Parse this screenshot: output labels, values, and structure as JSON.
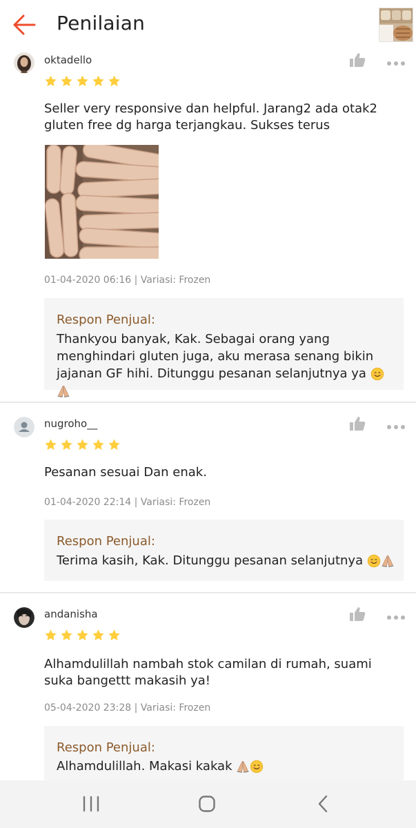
{
  "header": {
    "title": "Penilaian",
    "back_icon": "arrow-left-icon",
    "accent_color": "#ee4d2d"
  },
  "colors": {
    "star": "#ffce3d",
    "seller_label": "#8b5a2b",
    "meta": "#8b8b8b"
  },
  "reviews": [
    {
      "username": "oktadello",
      "rating": 5,
      "comment": "Seller very responsive dan helpful. Jarang2 ada otak2 gluten free dg harga terjangkau. Sukses terus",
      "meta": "01-04-2020 06:16 | Variasi: Frozen",
      "response_label": "Respon Penjual:",
      "response_text": "Thankyou banyak, Kak. Sebagai orang yang menghindari gluten juga, aku merasa senang bikin jajanan GF hihi. Ditunggu pesanan selanjutnya ya"
    },
    {
      "username": "nugroho__",
      "rating": 5,
      "comment": "Pesanan sesuai Dan enak.",
      "meta": "01-04-2020 22:14 | Variasi: Frozen",
      "response_label": "Respon Penjual:",
      "response_text": "Terima kasih, Kak. Ditunggu pesanan selanjutnya"
    },
    {
      "username": "andanisha",
      "rating": 5,
      "comment": "Alhamdulillah nambah stok camilan di rumah, suami suka bangettt makasih ya!",
      "meta": "05-04-2020 23:28 | Variasi: Frozen",
      "response_label": "Respon Penjual:",
      "response_text": "Alhamdulillah. Makasi kakak"
    }
  ],
  "nav": {
    "recent_icon": "recent-apps-icon",
    "home_icon": "home-icon",
    "back_icon": "nav-back-icon"
  }
}
